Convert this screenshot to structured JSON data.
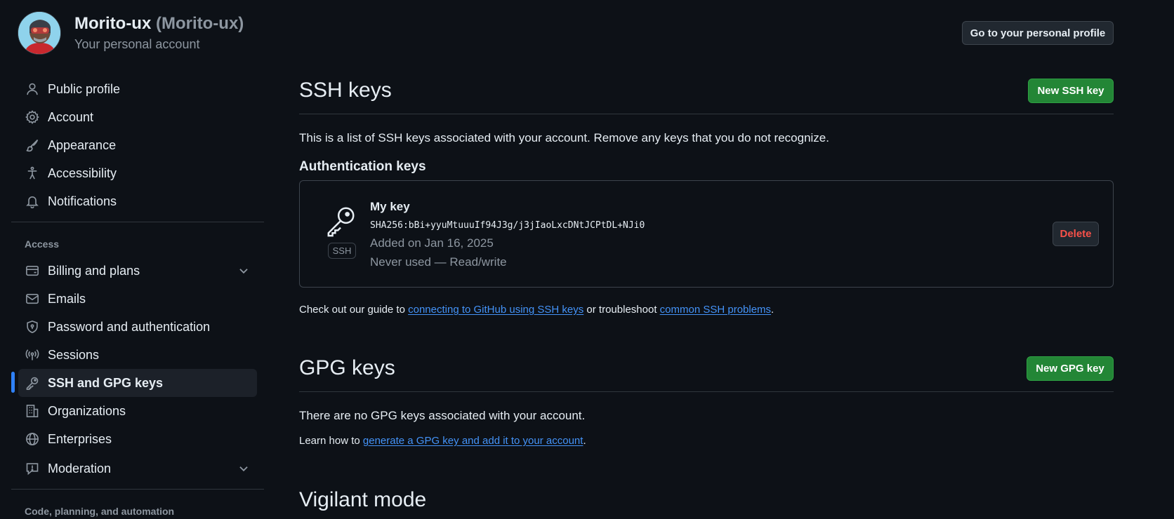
{
  "header": {
    "display_name": "Morito-ux",
    "login": "(Morito-ux)",
    "account_type": "Your personal account",
    "go_profile_label": "Go to your personal profile"
  },
  "sidebar": {
    "items": [
      {
        "label": "Public profile",
        "icon": "person-icon"
      },
      {
        "label": "Account",
        "icon": "gear-icon"
      },
      {
        "label": "Appearance",
        "icon": "paintbrush-icon"
      },
      {
        "label": "Accessibility",
        "icon": "accessibility-icon"
      },
      {
        "label": "Notifications",
        "icon": "bell-icon"
      }
    ],
    "access_heading": "Access",
    "access_items": [
      {
        "label": "Billing and plans",
        "icon": "credit-card-icon",
        "expandable": true
      },
      {
        "label": "Emails",
        "icon": "mail-icon"
      },
      {
        "label": "Password and authentication",
        "icon": "shield-lock-icon"
      },
      {
        "label": "Sessions",
        "icon": "broadcast-icon"
      },
      {
        "label": "SSH and GPG keys",
        "icon": "key-icon",
        "active": true
      },
      {
        "label": "Organizations",
        "icon": "organization-icon"
      },
      {
        "label": "Enterprises",
        "icon": "globe-icon"
      },
      {
        "label": "Moderation",
        "icon": "report-icon",
        "expandable": true
      }
    ],
    "code_heading": "Code, planning, and automation"
  },
  "ssh": {
    "title": "SSH keys",
    "new_button": "New SSH key",
    "description": "This is a list of SSH keys associated with your account. Remove any keys that you do not recognize.",
    "auth_heading": "Authentication keys",
    "key": {
      "title": "My key",
      "fingerprint": "SHA256:bBi+yyuMtuuuIf94J3g/j3jIaoLxcDNtJCPtDL+NJi0",
      "added": "Added on Jan 16, 2025",
      "usage": "Never used — Read/write",
      "badge": "SSH",
      "delete_label": "Delete"
    },
    "guide_prefix": "Check out our guide to ",
    "guide_link": "connecting to GitHub using SSH keys",
    "guide_middle": " or troubleshoot ",
    "guide_link2": "common SSH problems",
    "guide_suffix": "."
  },
  "gpg": {
    "title": "GPG keys",
    "new_button": "New GPG key",
    "empty_text": "There are no GPG keys associated with your account.",
    "learn_prefix": "Learn how to ",
    "learn_link": "generate a GPG key and add it to your account",
    "learn_suffix": "."
  },
  "vigilant": {
    "title": "Vigilant mode"
  },
  "colors": {
    "background": "#0d1117",
    "primary_button": "#238636",
    "link": "#4493f8",
    "danger": "#f85149",
    "active_indicator": "#2f81f7"
  }
}
